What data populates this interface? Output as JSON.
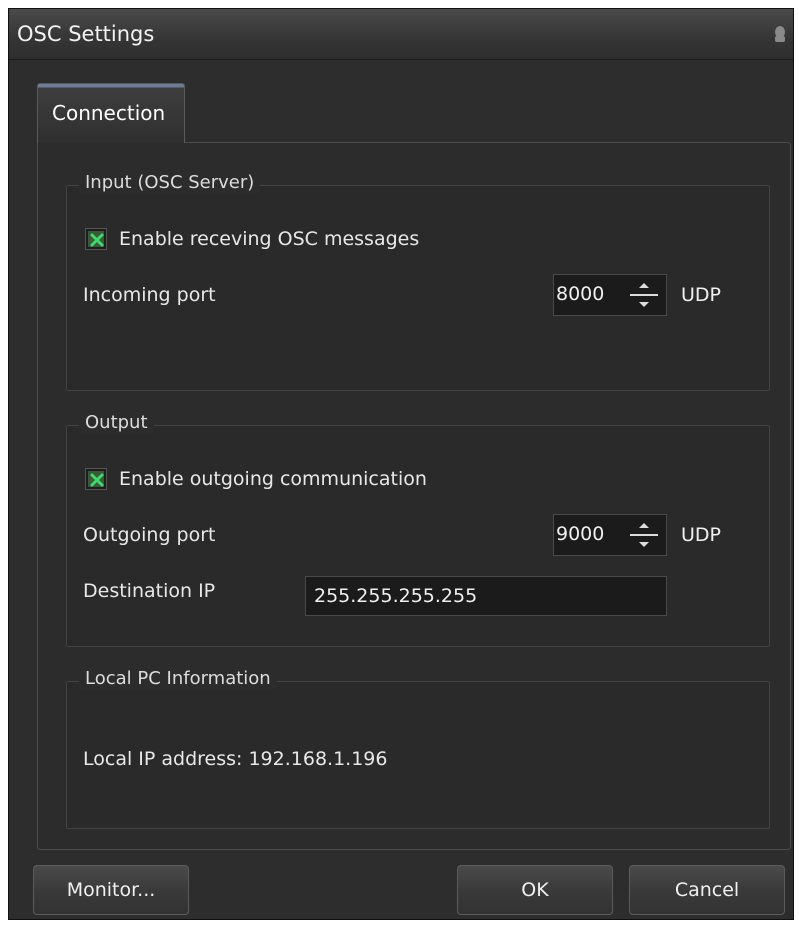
{
  "window": {
    "title": "OSC Settings"
  },
  "tabs": [
    {
      "label": "Connection",
      "active": true
    }
  ],
  "input_group": {
    "title": "Input (OSC Server)",
    "enable_label": "Enable receving OSC messages",
    "enable_checked": true,
    "port_label": "Incoming port",
    "port_value": "8000",
    "port_unit": "UDP"
  },
  "output_group": {
    "title": "Output",
    "enable_label": "Enable outgoing communication",
    "enable_checked": true,
    "port_label": "Outgoing port",
    "port_value": "9000",
    "port_unit": "UDP",
    "dest_label": "Destination IP",
    "dest_value": "255.255.255.255"
  },
  "local_group": {
    "title": "Local PC Information",
    "ip_text": "Local IP address: 192.168.1.196"
  },
  "buttons": {
    "monitor": "Monitor...",
    "ok": "OK",
    "cancel": "Cancel"
  },
  "colors": {
    "background": "#2d2d2d",
    "check_accent": "#3ddc6a",
    "tab_accent": "#6a7c96"
  }
}
